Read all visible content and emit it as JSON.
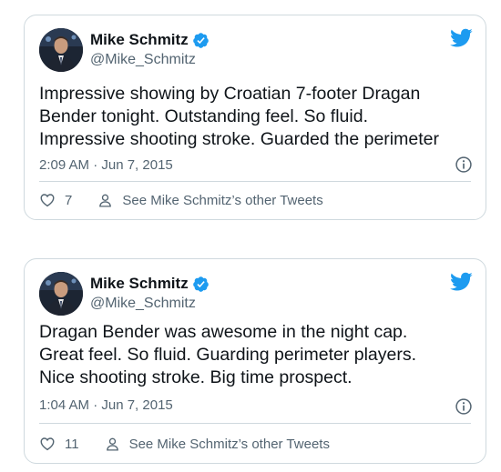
{
  "tweets": [
    {
      "author": {
        "name": "Mike Schmitz",
        "handle": "@Mike_Schmitz"
      },
      "text": "Impressive showing by Croatian 7-footer Dragan\nBender tonight. Outstanding feel. So fluid.\nImpressive shooting stroke. Guarded the perimeter",
      "timestamp": "2:09 AM · Jun 7, 2015",
      "likes": "7",
      "other_tweets_label": "See Mike Schmitz’s other Tweets"
    },
    {
      "author": {
        "name": "Mike Schmitz",
        "handle": "@Mike_Schmitz"
      },
      "text": "Dragan Bender was awesome in the night cap.\nGreat feel. So fluid. Guarding perimeter players.\nNice shooting stroke. Big time prospect.",
      "timestamp": "1:04 AM · Jun 7, 2015",
      "likes": "11",
      "other_tweets_label": "See Mike Schmitz’s other Tweets"
    }
  ],
  "icons": {
    "logo": "twitter-bird-icon",
    "verified": "verified-badge-icon",
    "info": "info-icon",
    "like": "heart-icon",
    "profile": "person-icon"
  },
  "colors": {
    "brand": "#1d9bf0",
    "text": "#0f1419",
    "secondary": "#536471",
    "border": "#cfd9de"
  }
}
